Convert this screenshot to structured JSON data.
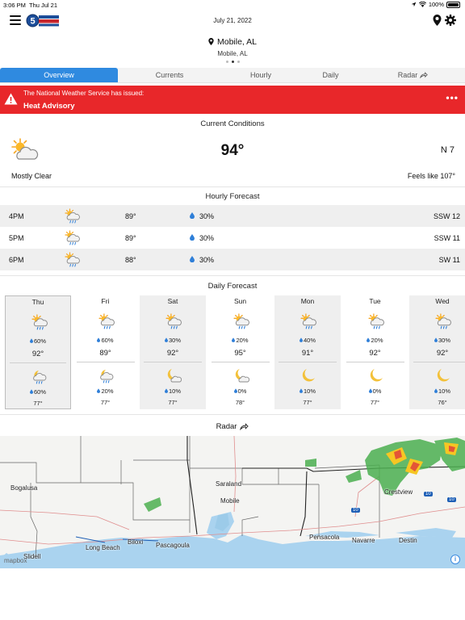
{
  "status_bar": {
    "time": "3:06 PM",
    "day": "Thu Jul 21",
    "battery": "100%"
  },
  "header": {
    "date": "July 21, 2022",
    "logo_icon": "station-logo-icon"
  },
  "location": {
    "name": "Mobile, AL",
    "subtitle": "Mobile, AL"
  },
  "tabs": [
    {
      "label": "Overview",
      "active": true
    },
    {
      "label": "Currents",
      "active": false
    },
    {
      "label": "Hourly",
      "active": false
    },
    {
      "label": "Daily",
      "active": false
    },
    {
      "label": "Radar",
      "active": false
    }
  ],
  "alert": {
    "line1": "The National Weather Service has issued:",
    "line2": "Heat Advisory",
    "more": "•••",
    "color": "#e8272a"
  },
  "current": {
    "title": "Current Conditions",
    "temp": "94°",
    "wind": "N 7",
    "description": "Mostly Clear",
    "feels_like": "Feels like 107°",
    "icon": "partly-sunny-icon"
  },
  "hourly": {
    "title": "Hourly Forecast",
    "rows": [
      {
        "time": "4PM",
        "temp": "89°",
        "precip": "30%",
        "wind": "SSW 12",
        "icon": "sun-rain-icon"
      },
      {
        "time": "5PM",
        "temp": "89°",
        "precip": "30%",
        "wind": "SSW 11",
        "icon": "sun-rain-icon"
      },
      {
        "time": "6PM",
        "temp": "88°",
        "precip": "30%",
        "wind": "SW 11",
        "icon": "sun-rain-icon"
      }
    ]
  },
  "daily": {
    "title": "Daily Forecast",
    "days": [
      {
        "name": "Thu",
        "day_precip": "60%",
        "high": "92°",
        "night_precip": "60%",
        "low": "77°",
        "night_icon": "moon-cloud-rain-icon"
      },
      {
        "name": "Fri",
        "day_precip": "60%",
        "high": "89°",
        "night_precip": "20%",
        "low": "77°",
        "night_icon": "moon-cloud-rain-icon"
      },
      {
        "name": "Sat",
        "day_precip": "30%",
        "high": "92°",
        "night_precip": "10%",
        "low": "77°",
        "night_icon": "moon-cloud-icon"
      },
      {
        "name": "Sun",
        "day_precip": "20%",
        "high": "95°",
        "night_precip": "0%",
        "low": "78°",
        "night_icon": "moon-cloud-icon"
      },
      {
        "name": "Mon",
        "day_precip": "40%",
        "high": "91°",
        "night_precip": "10%",
        "low": "77°",
        "night_icon": "moon-icon"
      },
      {
        "name": "Tue",
        "day_precip": "20%",
        "high": "92°",
        "night_precip": "0%",
        "low": "77°",
        "night_icon": "moon-icon"
      },
      {
        "name": "Wed",
        "day_precip": "30%",
        "high": "92°",
        "night_precip": "10%",
        "low": "76°",
        "night_icon": "moon-icon"
      }
    ]
  },
  "radar": {
    "title": "Radar",
    "places": [
      "Bogalusa",
      "Saraland",
      "Mobile",
      "Slidell",
      "Long Beach",
      "Biloxi",
      "Pascagoula",
      "Pensacola",
      "Navarre",
      "Destin",
      "Crestview"
    ],
    "highways": [
      "10",
      "10",
      "10"
    ],
    "attribution": "mapbox",
    "info": "i"
  }
}
